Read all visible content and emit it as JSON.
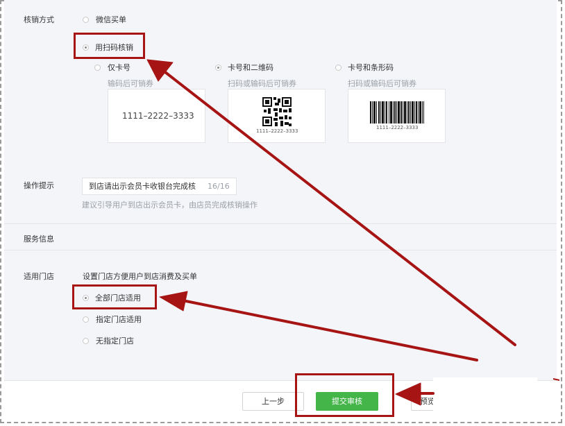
{
  "verify": {
    "label": "核销方式",
    "option_wechat": "微信买单",
    "option_scan": "用扫码核销",
    "sub_card_only": "仅卡号",
    "sub_card_qr": "卡号和二维码",
    "sub_card_barcode": "卡号和条形码",
    "hint_card_only": "输码后可销券",
    "hint_card_qr": "扫码或输码后可销券",
    "hint_card_barcode": "扫码或输码后可销券",
    "sample_code": "1111–2222–3333",
    "qr_code_caption": "1111–2222–3333",
    "barcode_caption": "1111–2222–3333"
  },
  "operation": {
    "label": "操作提示",
    "value": "到店请出示会员卡收银台完成核",
    "counter": "16/16",
    "tip": "建议引导用户到店出示会员卡，由店员完成核销操作"
  },
  "service": {
    "label": "服务信息"
  },
  "store": {
    "label": "适用门店",
    "desc": "设置门店方便用户到店消费及买单",
    "option_all": "全部门店适用",
    "option_specific": "指定门店适用",
    "option_none": "无指定门店"
  },
  "footer": {
    "prev_label": "上一步",
    "submit_label": "提交审核",
    "preview_partial": "预览"
  },
  "colors": {
    "annotation_red": "#a61414",
    "submit_green": "#44b549",
    "panel_bg": "#f4f5f9"
  }
}
